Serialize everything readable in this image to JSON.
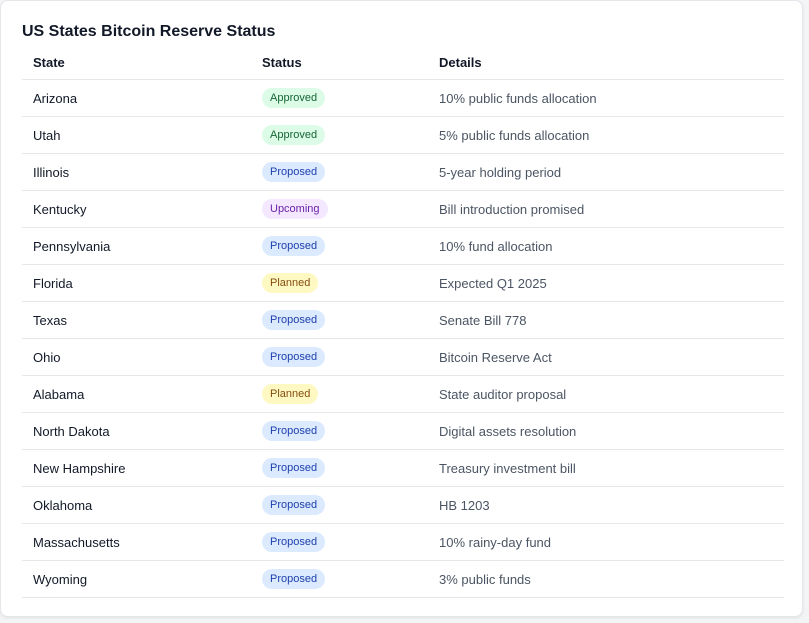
{
  "title": "US States Bitcoin Reserve Status",
  "columns": [
    "State",
    "Status",
    "Details"
  ],
  "rows": [
    {
      "state": "Arizona",
      "status": "Approved",
      "details": "10% public funds allocation"
    },
    {
      "state": "Utah",
      "status": "Approved",
      "details": "5% public funds allocation"
    },
    {
      "state": "Illinois",
      "status": "Proposed",
      "details": "5-year holding period"
    },
    {
      "state": "Kentucky",
      "status": "Upcoming",
      "details": "Bill introduction promised"
    },
    {
      "state": "Pennsylvania",
      "status": "Proposed",
      "details": "10% fund allocation"
    },
    {
      "state": "Florida",
      "status": "Planned",
      "details": "Expected Q1 2025"
    },
    {
      "state": "Texas",
      "status": "Proposed",
      "details": "Senate Bill 778"
    },
    {
      "state": "Ohio",
      "status": "Proposed",
      "details": "Bitcoin Reserve Act"
    },
    {
      "state": "Alabama",
      "status": "Planned",
      "details": "State auditor proposal"
    },
    {
      "state": "North Dakota",
      "status": "Proposed",
      "details": "Digital assets resolution"
    },
    {
      "state": "New Hampshire",
      "status": "Proposed",
      "details": "Treasury investment bill"
    },
    {
      "state": "Oklahoma",
      "status": "Proposed",
      "details": "HB 1203"
    },
    {
      "state": "Massachusetts",
      "status": "Proposed",
      "details": "10% rainy-day fund"
    },
    {
      "state": "Wyoming",
      "status": "Proposed",
      "details": "3% public funds"
    }
  ],
  "status_colors": {
    "Approved": {
      "bg": "#dcfce7",
      "fg": "#166534"
    },
    "Proposed": {
      "bg": "#dbeafe",
      "fg": "#1e40af"
    },
    "Upcoming": {
      "bg": "#f3e8ff",
      "fg": "#6b21a8"
    },
    "Planned": {
      "bg": "#fef9c3",
      "fg": "#854d0e"
    }
  }
}
